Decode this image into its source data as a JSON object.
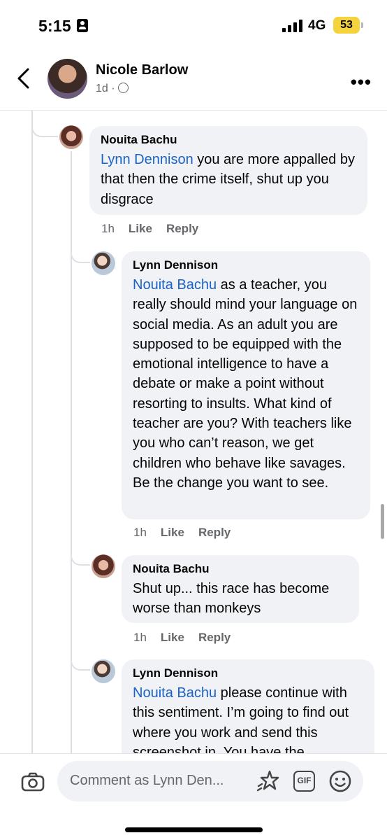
{
  "status_bar": {
    "time": "5:15",
    "network": "4G",
    "battery": "53"
  },
  "header": {
    "name": "Nicole Barlow",
    "age": "1d ·"
  },
  "comments": [
    {
      "author": "Nouita Bachu",
      "mention": "Lynn Dennison",
      "text": " you are more appalled by that then the crime itself, shut up you disgrace",
      "time": "1h",
      "like": "Like",
      "reply": "Reply"
    },
    {
      "author": "Lynn Dennison",
      "mention": "Nouita Bachu",
      "text": " as a teacher, you really should mind your language on social media. As an adult you are supposed to be equipped with the emotional intelligence to have a debate or make a point without resorting to insults. What kind of teacher are you? With teachers like you who can’t reason, we get children who behave like savages. Be the change you want to see.",
      "time": "1h",
      "like": "Like",
      "reply": "Reply"
    },
    {
      "author": "Nouita Bachu",
      "text": "Shut up... this race has become worse than monkeys",
      "time": "1h",
      "like": "Like",
      "reply": "Reply"
    },
    {
      "author": "Lynn Dennison",
      "mention": "Nouita Bachu",
      "text": " please continue with this sentiment. I’m going to find out where you work and send this screenshot in. You have the"
    }
  ],
  "composer": {
    "placeholder": "Comment as Lynn Den...",
    "gif_label": "GIF"
  }
}
